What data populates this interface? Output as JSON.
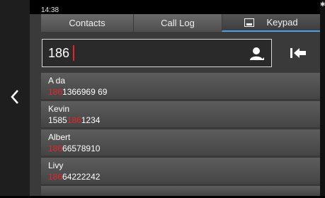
{
  "status": {
    "time": "14:38",
    "bluetooth_icon": "bluetooth-icon"
  },
  "tabs": [
    {
      "label": "Contacts",
      "active": false
    },
    {
      "label": "Call Log",
      "active": false
    },
    {
      "label": "Keypad",
      "active": true,
      "icon": "keypad-icon"
    }
  ],
  "search": {
    "value": "186"
  },
  "contacts": [
    {
      "name": "A da",
      "number_pre": "",
      "number_match": "186",
      "number_post": "1366969 69"
    },
    {
      "name": "Kevin",
      "number_pre": "1585",
      "number_match": "186",
      "number_post": "1234"
    },
    {
      "name": "Albert",
      "number_pre": "",
      "number_match": "186",
      "number_post": "66578910"
    },
    {
      "name": "Livy",
      "number_pre": "",
      "number_match": "186",
      "number_post": "64222242"
    }
  ],
  "colors": {
    "accent": "#4aa3ea",
    "highlight": "#e3262a",
    "background": "#3a3a3a"
  }
}
